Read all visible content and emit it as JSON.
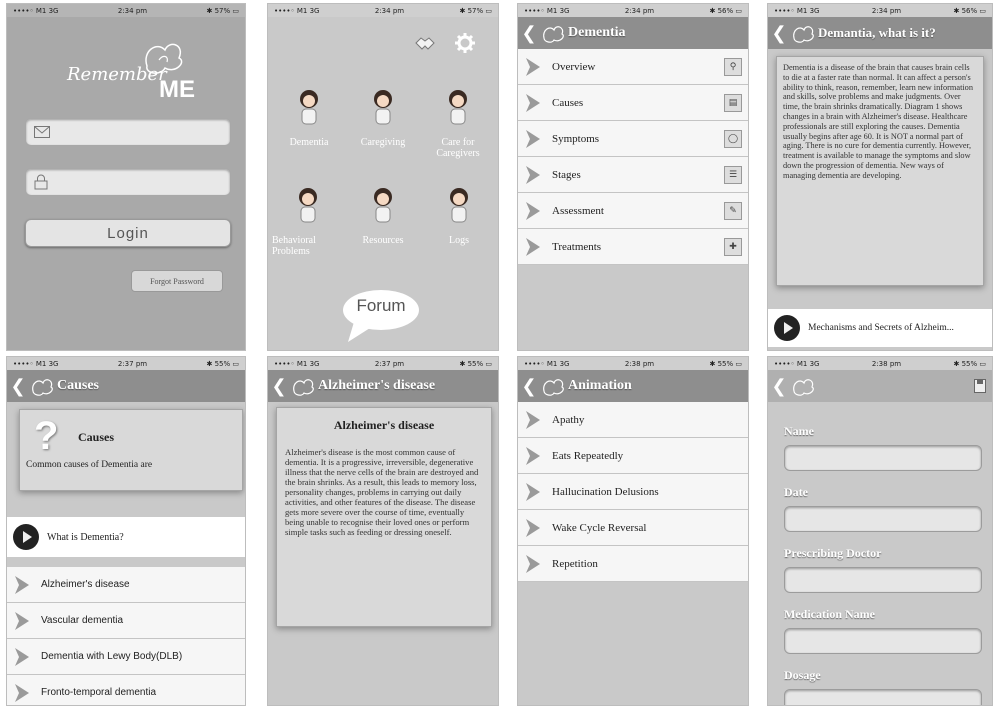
{
  "status": {
    "carrier": "••••◦ M1 3G",
    "times": [
      "2:34 pm",
      "2:34 pm",
      "2:34 pm",
      "2:34 pm",
      "2:37 pm",
      "2:37 pm",
      "2:38 pm",
      "2:38 pm"
    ],
    "batteries": [
      "✱ 57% ▭",
      "✱ 57% ▭",
      "✱ 56% ▭",
      "✱ 56% ▭",
      "✱ 55% ▭",
      "✱ 55% ▭",
      "✱ 55% ▭",
      "✱ 55% ▭"
    ]
  },
  "login": {
    "logo_script": "Remember",
    "logo_bold": "ME",
    "login_label": "Login",
    "forgot_label": "Forgot Password"
  },
  "home": {
    "tiles": [
      {
        "label": "Dementia"
      },
      {
        "label": "Caregiving"
      },
      {
        "label": "Care for Caregivers"
      },
      {
        "label": "Behavioral Problems"
      },
      {
        "label": "Resources"
      },
      {
        "label": "Logs"
      }
    ],
    "forum_label": "Forum"
  },
  "dementia_menu": {
    "title": "Dementia",
    "items": [
      "Overview",
      "Causes",
      "Symptoms",
      "Stages",
      "Assessment",
      "Treatments"
    ]
  },
  "what_is": {
    "title": "Demantia, what is it?",
    "body": "Dementia is a disease of the brain that causes brain cells to die at a faster rate than normal. It can affect a person's ability to think, reason, remember, learn new information and skills, solve problems and make judgments. Over time, the brain shrinks dramatically. Diagram 1 shows changes in a brain with Alzheimer's disease. Healthcare professionals are still exploring the causes. Dementia usually begins after age 60. It is NOT a normal part of aging. There is no cure for dementia currently. However, treatment is available to manage the symptoms and slow down the progression of dementia. New ways of managing dementia are developing.",
    "video_label": "Mechanisms and Secrets of Alzheim..."
  },
  "causes": {
    "title": "Causes",
    "card_heading": "Causes",
    "card_text": "Common causes of Dementia are",
    "video_label": "What is Dementia?",
    "items": [
      "Alzheimer's disease",
      "Vascular dementia",
      "Dementia with Lewy Body(DLB)",
      "Fronto-temporal dementia"
    ]
  },
  "alz": {
    "title": "Alzheimer's disease",
    "card_heading": "Alzheimer's disease",
    "body": "Alzheimer's disease is the most common cause of dementia. It is a progressive, irreversible, degenerative illness that the nerve cells of the brain are destroyed and the brain shrinks. As a result, this leads to memory loss, personality changes, problems in carrying out daily activities, and other features of the disease. The disease gets more severe over the course of time, eventually being unable to recognise their loved ones or perform simple tasks such as feeding or dressing oneself."
  },
  "animation": {
    "title": "Animation",
    "items": [
      "Apathy",
      "Eats Repeatedly",
      "Hallucination Delusions",
      "Wake Cycle Reversal",
      "Repetition"
    ]
  },
  "form": {
    "labels": [
      "Name",
      "Date",
      "Prescribing Doctor",
      "Medication Name",
      "Dosage"
    ]
  },
  "colors": {
    "navbar": "#8e8e8e",
    "screen_bg": "#c9c9c9",
    "row_bg": "#f6f6f6",
    "chevron": "#9a9a9a"
  }
}
